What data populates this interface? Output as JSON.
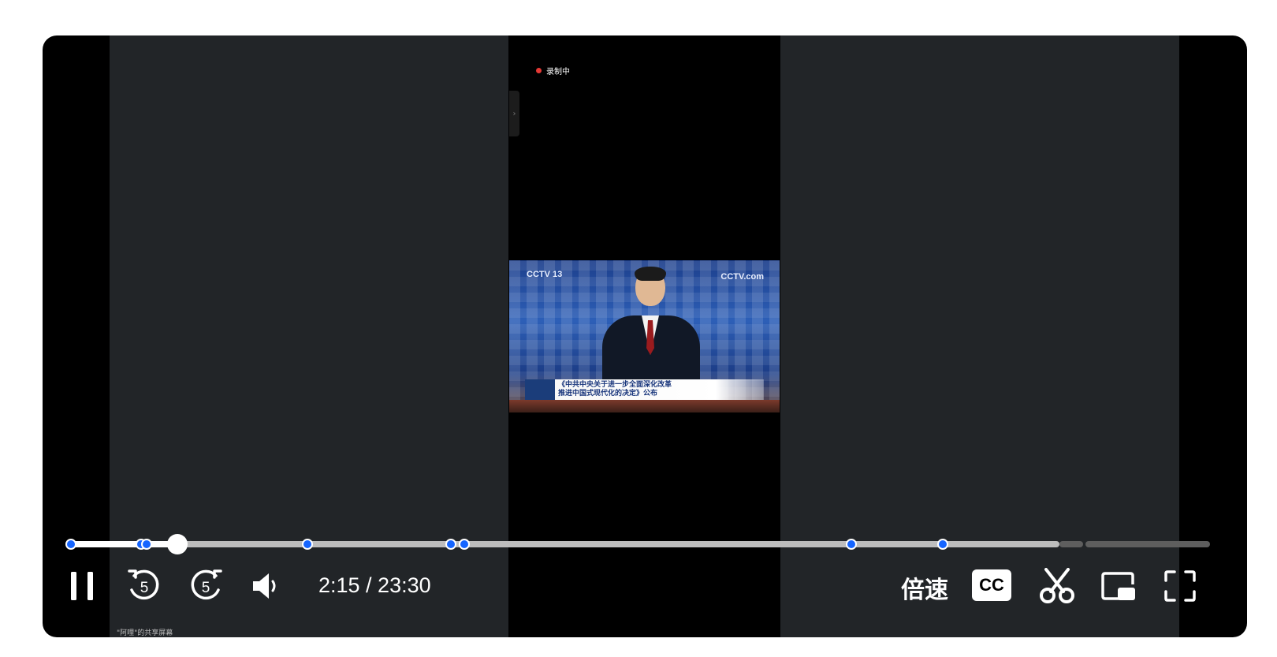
{
  "video": {
    "recording_label": "录制中",
    "side_tab_glyph": "›",
    "frame_logo_left": "CCTV 13",
    "frame_logo_right": "CCTV.com",
    "caption_line1": "《中共中央关于进一步全面深化改革",
    "caption_line2": "推进中国式现代化的决定》公布",
    "sharer_label": "\"阿哩\"的共享屏幕"
  },
  "playback": {
    "current_time": "2:15",
    "total_time": "23:30",
    "time_display": "2:15 / 23:30",
    "progress_fraction": 0.0957,
    "chapter_markers_fraction": [
      0.0043,
      0.0645,
      0.0695,
      0.2082,
      0.3323,
      0.3436,
      0.6775,
      0.7568
    ]
  },
  "controls": {
    "pause_icon": "pause-icon",
    "rewind_seconds": "5",
    "forward_seconds": "5",
    "volume_icon": "volume-icon",
    "speed_label": "倍速",
    "cc_label": "CC",
    "clip_icon": "scissors-icon",
    "pip_icon": "picture-in-picture-icon",
    "fullscreen_icon": "fullscreen-icon"
  },
  "colors": {
    "accent": "#1565ff",
    "recording": "#e53935"
  }
}
